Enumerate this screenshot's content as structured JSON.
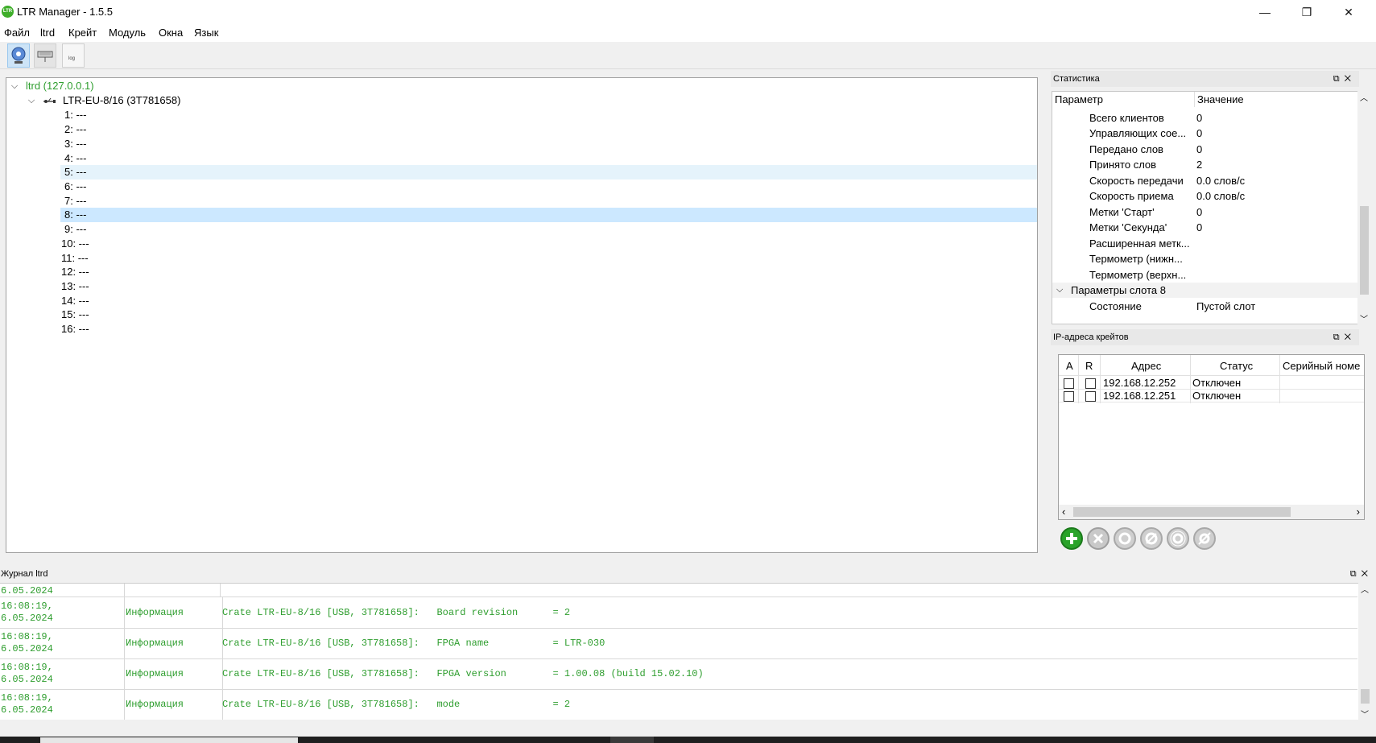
{
  "window": {
    "title": "LTR Manager - 1.5.5",
    "icon_text": "LTR",
    "min": "—",
    "restore": "❐",
    "close": "✕"
  },
  "menu": [
    "Файл",
    "ltrd",
    "Крейт",
    "Модуль",
    "Окна",
    "Язык"
  ],
  "toolbar": {
    "buttons": [
      {
        "name": "server-connect-icon",
        "active": true
      },
      {
        "name": "crate-icon",
        "active": false
      },
      {
        "name": "log-icon",
        "active": false,
        "label": "log"
      }
    ]
  },
  "tree": {
    "root": "ltrd (127.0.0.1)",
    "crate": "LTR-EU-8/16 (3T781658)",
    "slots": [
      "1: ---",
      "2: ---",
      "3: ---",
      "4: ---",
      "5: ---",
      "6: ---",
      "7: ---",
      "8: ---",
      "9: ---",
      "10: ---",
      "11: ---",
      "12: ---",
      "13: ---",
      "14: ---",
      "15: ---",
      "16: ---"
    ],
    "hover_slot": "5",
    "selected_slot": "8"
  },
  "stats": {
    "title": "Статистика",
    "headers": [
      "Параметр",
      "Значение"
    ],
    "rows": [
      [
        "Всего клиентов",
        "0"
      ],
      [
        "Управляющих сое...",
        "0"
      ],
      [
        "Передано слов",
        "0"
      ],
      [
        "Принято слов",
        "2"
      ],
      [
        "Скорость передачи",
        "0.0 слов/с"
      ],
      [
        "Скорость приема",
        "0.0 слов/с"
      ],
      [
        "Метки 'Старт'",
        "0"
      ],
      [
        "Метки 'Секунда'",
        "0"
      ],
      [
        "Расширенная метк...",
        ""
      ],
      [
        "Термометр (нижн...",
        ""
      ],
      [
        "Термометр (верхн...",
        ""
      ]
    ],
    "group": "Параметры слота 8",
    "group_rows": [
      [
        "Состояние",
        "Пустой слот"
      ]
    ]
  },
  "ip": {
    "title": "IP-адреса крейтов",
    "headers": [
      "A",
      "R",
      "Адрес",
      "Статус",
      "Серийный номе"
    ],
    "rows": [
      {
        "address": "192.168.12.252",
        "status": "Отключен",
        "serial": ""
      },
      {
        "address": "192.168.12.251",
        "status": "Отключен",
        "serial": ""
      }
    ]
  },
  "log": {
    "title": "Журнал ltrd",
    "partial_date": "6.05.2024",
    "rows": [
      {
        "time": "16:08:19,",
        "date": "6.05.2024",
        "level": "Информация",
        "message": "Crate LTR-EU-8/16 [USB, 3T781658]:   Board revision      = 2"
      },
      {
        "time": "16:08:19,",
        "date": "6.05.2024",
        "level": "Информация",
        "message": "Crate LTR-EU-8/16 [USB, 3T781658]:   FPGA name           = LTR-030"
      },
      {
        "time": "16:08:19,",
        "date": "6.05.2024",
        "level": "Информация",
        "message": "Crate LTR-EU-8/16 [USB, 3T781658]:   FPGA version        = 1.00.08 (build 15.02.10)"
      },
      {
        "time": "16:08:19,",
        "date": "6.05.2024",
        "level": "Информация",
        "message": "Crate LTR-EU-8/16 [USB, 3T781658]:   mode                = 2"
      }
    ]
  },
  "dock_icons": {
    "float": "⧉",
    "close": "✕"
  },
  "colors": {
    "tree_root": "#2f9e2f",
    "log_text": "#2f9e2f",
    "selection": "#cce8ff",
    "hover": "#e5f3fb",
    "add_button": "#2aa32a"
  }
}
